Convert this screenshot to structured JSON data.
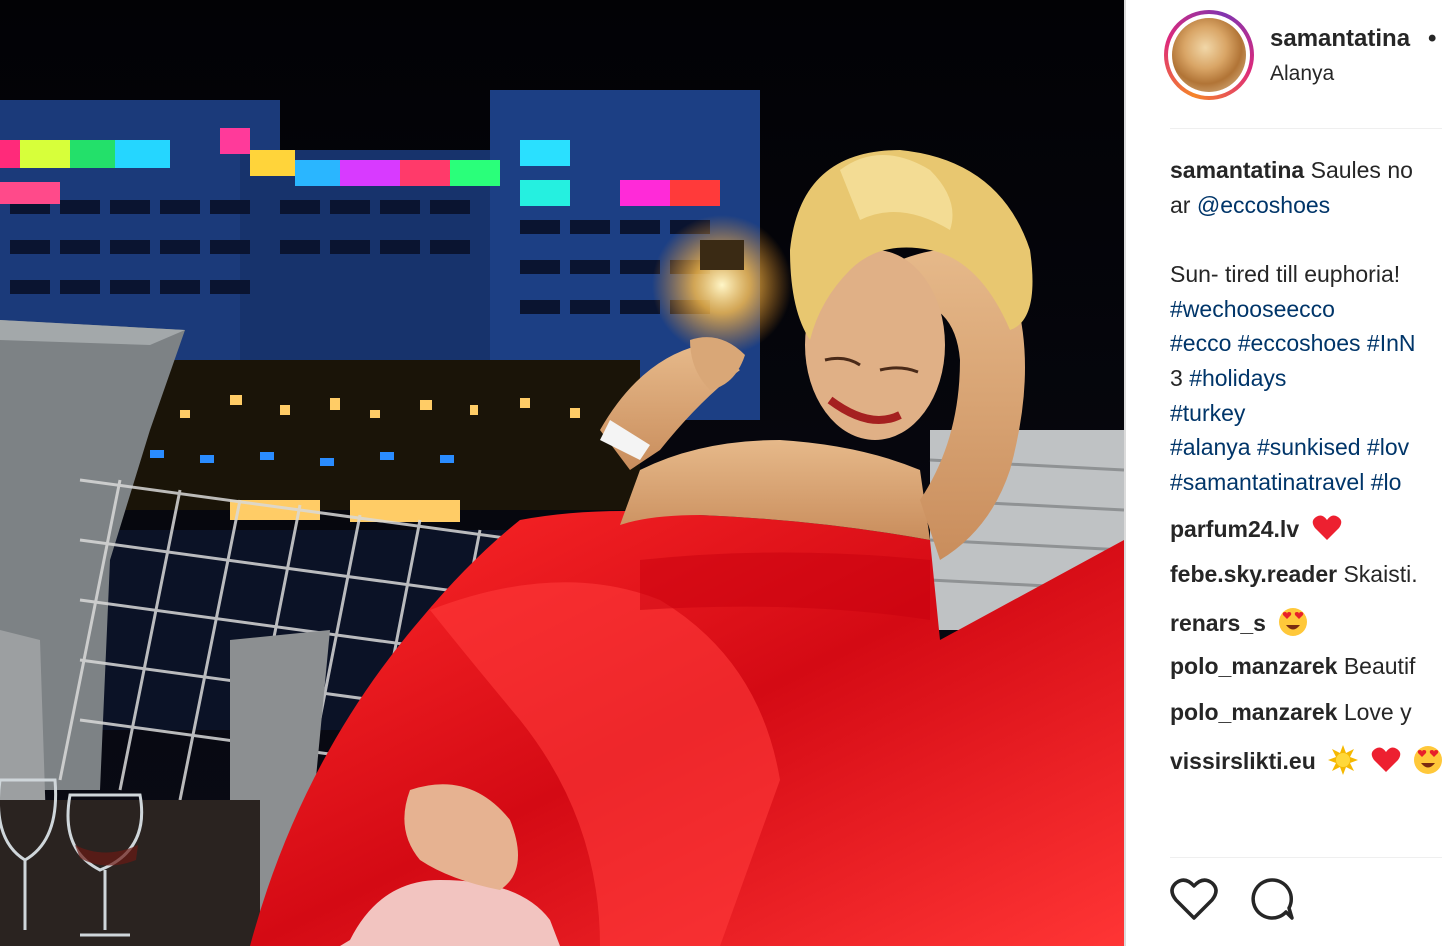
{
  "post": {
    "username": "samantatina",
    "separator": "•",
    "location": "Alanya"
  },
  "caption": {
    "author": "samantatina",
    "line1_text": "Saules no",
    "line2_prefix": "ar ",
    "line2_mention": "@eccoshoes",
    "line3": "Sun- tired till euphoria!",
    "line4": "#wechooseecco",
    "line5": "#ecco #eccoshoes #InN",
    "line6_prefix": "3 ",
    "line6_tag": "#holidays",
    "line7": "#turkey",
    "line8": "#alanya #sunkised #lov",
    "line9": "#samantatinatravel #lo"
  },
  "comments": [
    {
      "user": "parfum24.lv",
      "text": "",
      "emoji": [
        "heart"
      ]
    },
    {
      "user": "febe.sky.reader",
      "text": "Skaisti.",
      "emoji": []
    },
    {
      "user": "renars_s",
      "text": "",
      "emoji": [
        "heart-eyes"
      ]
    },
    {
      "user": "polo_manzarek",
      "text": "Beautif",
      "emoji": []
    },
    {
      "user": "polo_manzarek",
      "text": "Love y",
      "emoji": []
    },
    {
      "user": "vissirslikti.eu",
      "text": "",
      "emoji": [
        "sun",
        "heart",
        "heart-eyes"
      ]
    }
  ],
  "icons": {
    "like": "heart-outline-icon",
    "comment": "speech-bubble-icon"
  },
  "colors": {
    "text": "#262626",
    "link": "#003569",
    "heart": "#ed4956",
    "dress": "#e01020"
  }
}
